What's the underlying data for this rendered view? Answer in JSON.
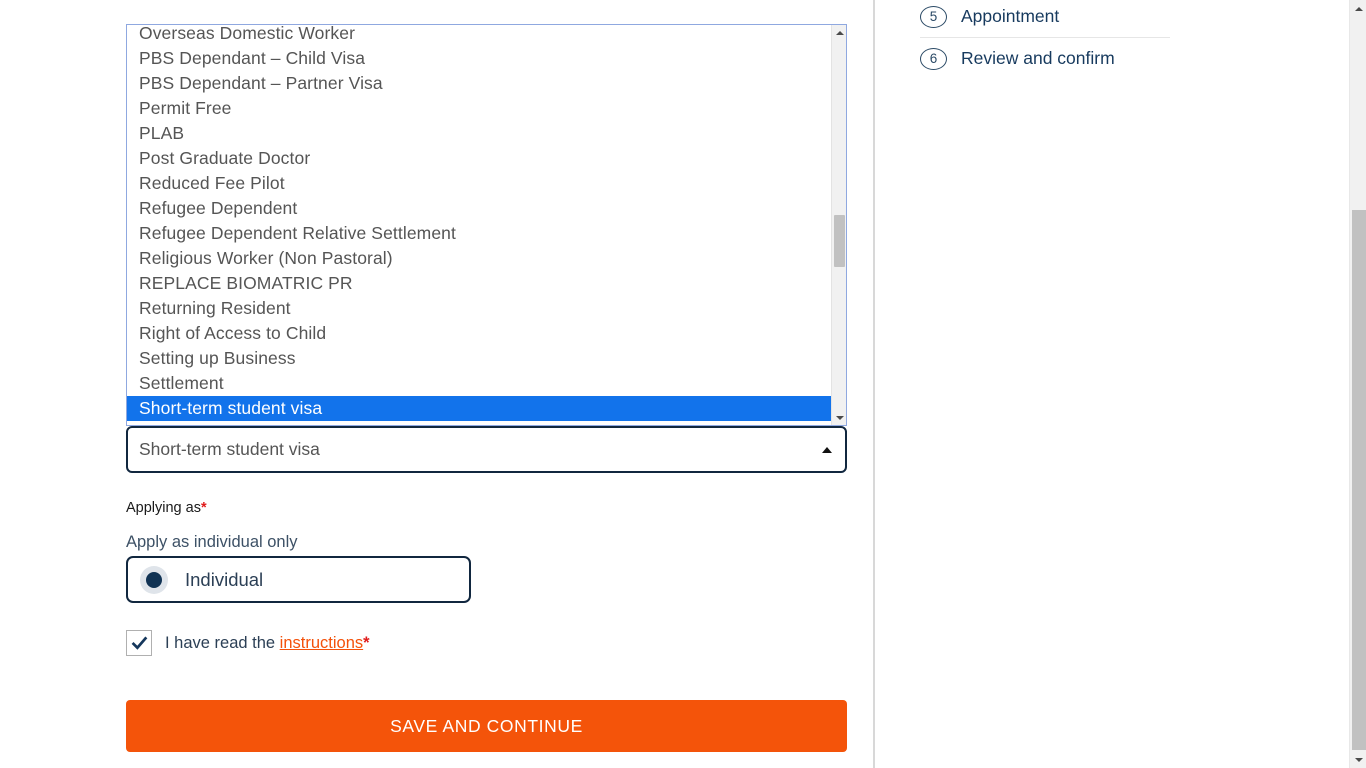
{
  "dropdown": {
    "name": "visa-type",
    "selected_value": "Short-term student visa",
    "caret_icon": "chevron-up-icon",
    "options": [
      "Overseas Domestic Worker",
      "PBS Dependant – Child Visa",
      "PBS Dependant – Partner Visa",
      "Permit Free",
      "PLAB",
      "Post Graduate Doctor",
      "Reduced Fee Pilot",
      "Refugee Dependent",
      "Refugee Dependent Relative Settlement",
      "Religious Worker (Non Pastoral)",
      "REPLACE BIOMATRIC PR",
      "Returning Resident",
      "Right of Access to Child",
      "Setting up Business",
      "Settlement",
      "Short-term student visa"
    ],
    "selected_index": 15,
    "highlight_color": "#1273eb",
    "scrollbar": {
      "up_arrow_icon": "triangle-up-icon",
      "down_arrow_icon": "triangle-down-icon"
    }
  },
  "applying_as": {
    "label": "Applying as",
    "required_marker": "*",
    "sub_label": "Apply as individual only",
    "radio": {
      "label": "Individual",
      "checked": true,
      "dot_color": "#113354"
    }
  },
  "consent": {
    "checked": true,
    "checkbox_icon": "checkmark-icon",
    "text_before": "I have read the ",
    "link_text": "instructions",
    "required_marker": "*",
    "link_color": "#f4510a"
  },
  "actions": {
    "primary_button_label": "SAVE AND CONTINUE",
    "primary_button_color": "#f4540a"
  },
  "steps": [
    {
      "number": "5",
      "label": "Appointment"
    },
    {
      "number": "6",
      "label": "Review and confirm"
    }
  ],
  "page_scrollbar": {
    "up_arrow_icon": "triangle-up-icon",
    "down_arrow_icon": "triangle-down-icon"
  }
}
